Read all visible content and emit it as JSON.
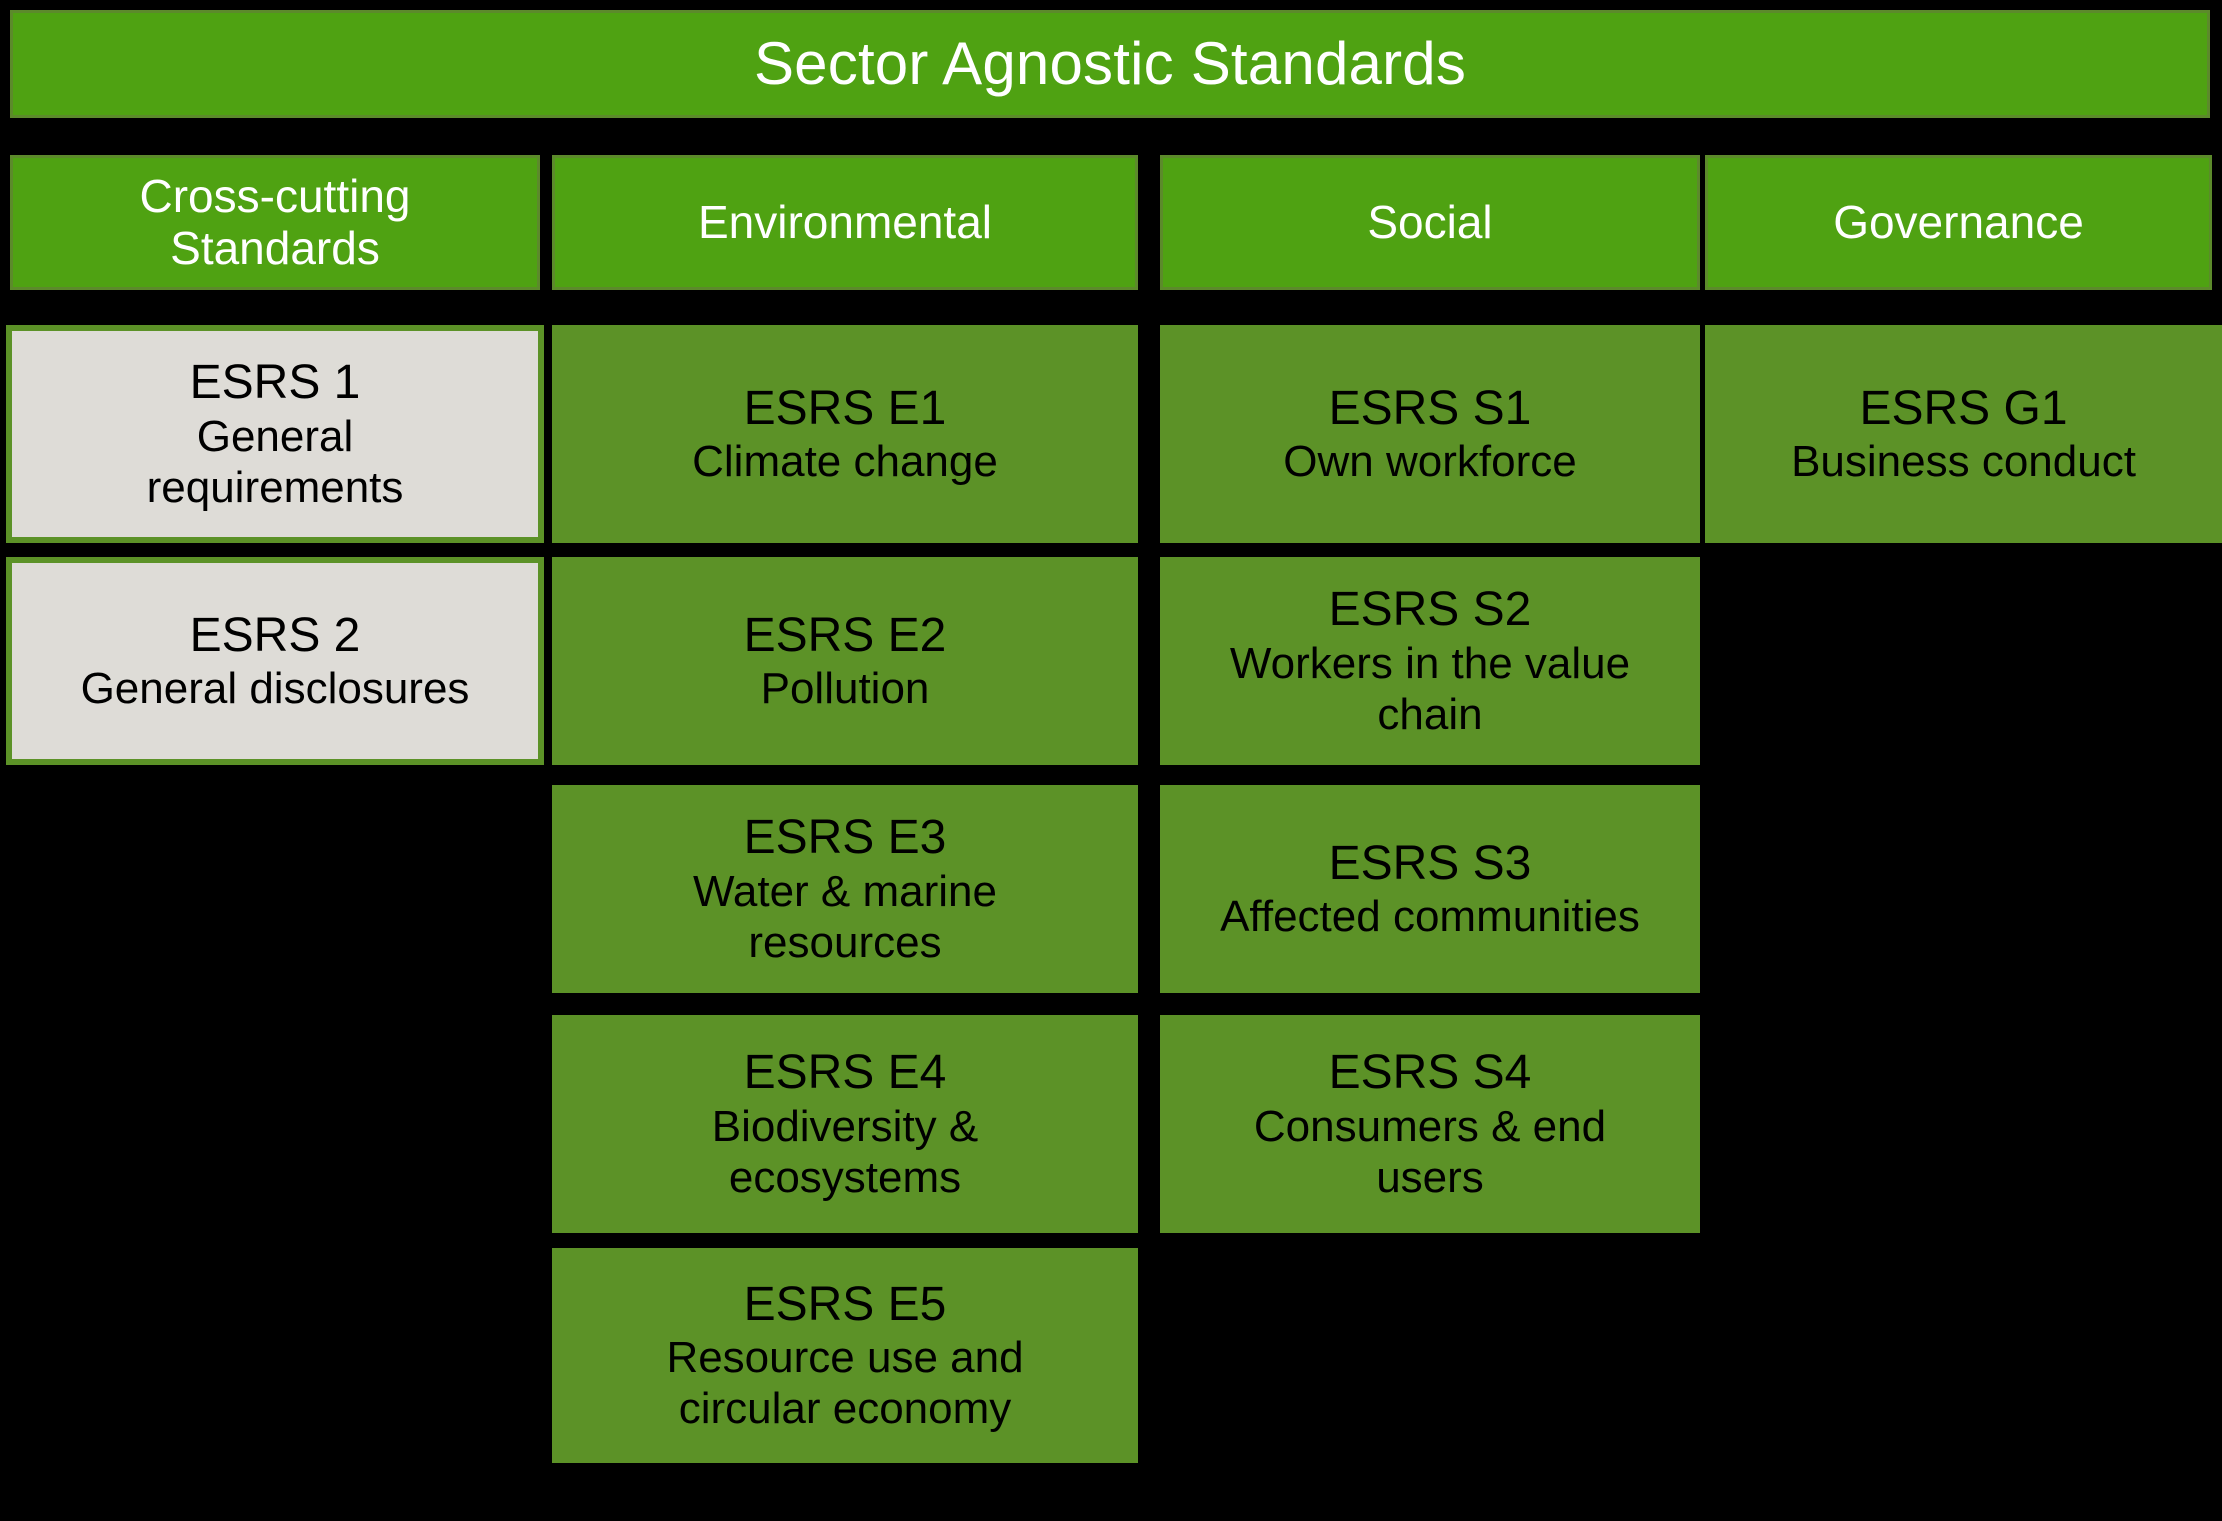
{
  "banner": {
    "title": "Sector Agnostic Standards"
  },
  "colors": {
    "background": "#000000",
    "header_green": "#4FA212",
    "header_border": "#5C8A2B",
    "cell_green": "#5C9227",
    "crosscutting_fill": "#DEDCD7",
    "crosscutting_border": "#5C9227",
    "header_text": "#FFFFFF",
    "cell_text": "#000000"
  },
  "columns": [
    {
      "key": "cross_cutting",
      "header_line1": "Cross-cutting",
      "header_line2": "Standards",
      "items": [
        {
          "code": "ESRS 1",
          "desc_line1": "General",
          "desc_line2": "requirements"
        },
        {
          "code": "ESRS 2",
          "desc_line1": "General disclosures",
          "desc_line2": ""
        }
      ]
    },
    {
      "key": "environmental",
      "header_line1": "Environmental",
      "header_line2": "",
      "items": [
        {
          "code": "ESRS E1",
          "desc_line1": "Climate change",
          "desc_line2": ""
        },
        {
          "code": "ESRS E2",
          "desc_line1": "Pollution",
          "desc_line2": ""
        },
        {
          "code": "ESRS E3",
          "desc_line1": "Water & marine",
          "desc_line2": "resources"
        },
        {
          "code": "ESRS E4",
          "desc_line1": "Biodiversity &",
          "desc_line2": "ecosystems"
        },
        {
          "code": "ESRS E5",
          "desc_line1": "Resource use and",
          "desc_line2": "circular economy"
        }
      ]
    },
    {
      "key": "social",
      "header_line1": "Social",
      "header_line2": "",
      "items": [
        {
          "code": "ESRS S1",
          "desc_line1": "Own workforce",
          "desc_line2": ""
        },
        {
          "code": "ESRS S2",
          "desc_line1": "Workers in the value",
          "desc_line2": "chain"
        },
        {
          "code": "ESRS S3",
          "desc_line1": "Affected communities",
          "desc_line2": ""
        },
        {
          "code": "ESRS S4",
          "desc_line1": "Consumers & end",
          "desc_line2": "users"
        }
      ]
    },
    {
      "key": "governance",
      "header_line1": "Governance",
      "header_line2": "",
      "items": [
        {
          "code": "ESRS G1",
          "desc_line1": "Business conduct",
          "desc_line2": ""
        }
      ]
    }
  ]
}
